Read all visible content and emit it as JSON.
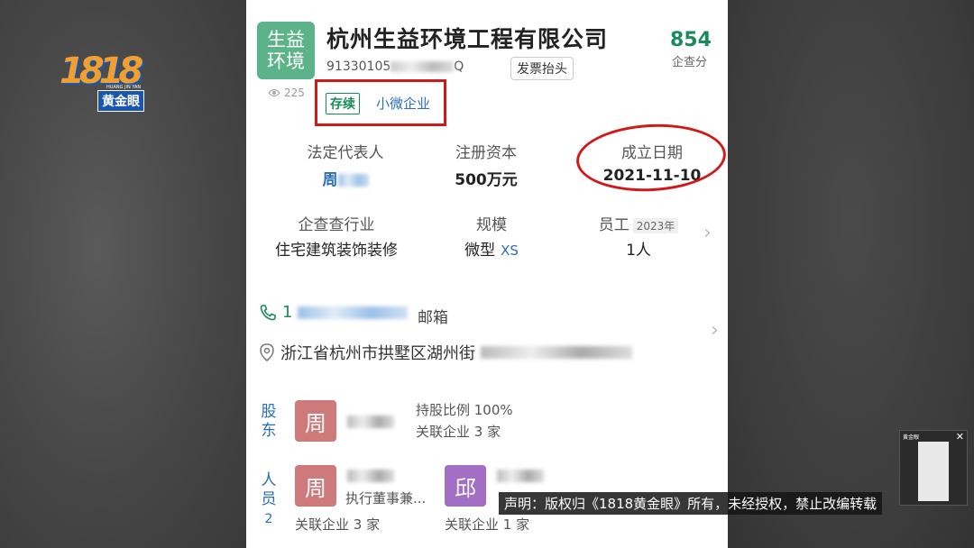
{
  "watermark": {
    "number": "1818",
    "name": "黄金眼",
    "tiny": "HUANG JIN YAN"
  },
  "company": {
    "logo_text": "生益环境",
    "name": "杭州生益环境工程有限公司",
    "credit_code_prefix": "91330105",
    "credit_code_suffix": "Q",
    "invoice_button": "发票抬头",
    "score": "854",
    "score_label": "企查分",
    "views": "225",
    "status_tag": "存续",
    "scale_tag": "小微企业"
  },
  "basic_info": {
    "legal_rep_label": "法定代表人",
    "legal_rep_value": "周",
    "capital_label": "注册资本",
    "capital_value": "500万元",
    "founded_label": "成立日期",
    "founded_value": "2021-11-10",
    "industry_label": "企查查行业",
    "industry_value": "住宅建筑装饰装修",
    "scale_label": "规模",
    "scale_value": "微型",
    "scale_code": "XS",
    "staff_label": "员工",
    "staff_year": "2023年",
    "staff_value": "1人"
  },
  "contact": {
    "phone_prefix": "1",
    "email_label": "邮箱",
    "address_prefix": "浙江省杭州市拱墅区湖州街"
  },
  "shareholders": {
    "label": "股东",
    "avatar": "周",
    "share_ratio": "持股比例 100%",
    "related": "关联企业 3 家"
  },
  "personnel": {
    "label": "人员",
    "count": "2",
    "p1_avatar": "周",
    "p1_role": "执行董事兼...",
    "p1_related": "关联企业 3 家",
    "p2_avatar": "邱",
    "p2_related": "关联企业 1 家"
  },
  "overlay": {
    "notice": "声明：版权归《1818黄金眼》所有，未经授权，禁止改编转载"
  }
}
